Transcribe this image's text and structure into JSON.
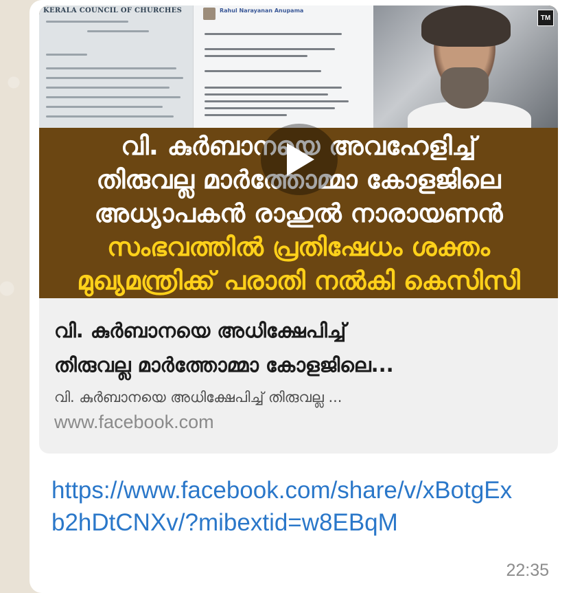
{
  "thumbnail": {
    "doc_header": "KERALA COUNCIL OF CHURCHES",
    "post_author": "Rahul Narayanan Anupama",
    "badge": "TM",
    "headline_lines": [
      {
        "text": "വി. കുർബാനയെ അവഹേളിച്ച്",
        "color": "white"
      },
      {
        "text": "തിരുവല്ല മാർത്തോമ്മാ കോളജിലെ",
        "color": "white"
      },
      {
        "text": "അധ്യാപകൻ രാഹുൽ നാരായണൻ",
        "color": "white"
      },
      {
        "text": "സംഭവത്തിൽ പ്രതിഷേധം ശക്തം",
        "color": "yellow"
      },
      {
        "text": "മുഖ്യമന്ത്രിക്ക് പരാതി നൽകി കെസിസി",
        "color": "yellow"
      }
    ]
  },
  "preview": {
    "title_line1": "വി. കുർബാനയെ അധിക്ഷേപിച്ച്",
    "title_line2": "തിരുവല്ല മാർത്തോമ്മാ കോളജിലെ...",
    "description": "വി. കുർബാനയെ അധിക്ഷേപിച്ച് തിരുവല്ല ...",
    "domain": "www.facebook.com"
  },
  "message": {
    "link": "https://www.facebook.com/share/v/xBotgExb2hDtCNXv/?mibextid=w8EBqM",
    "time": "22:35"
  },
  "colors": {
    "link": "#2a77c9",
    "headline_bg": "#6b4612",
    "headline_yellow": "#ffd11a",
    "chat_bg": "#e9e2d6"
  },
  "icons": {
    "play": "play-icon"
  }
}
